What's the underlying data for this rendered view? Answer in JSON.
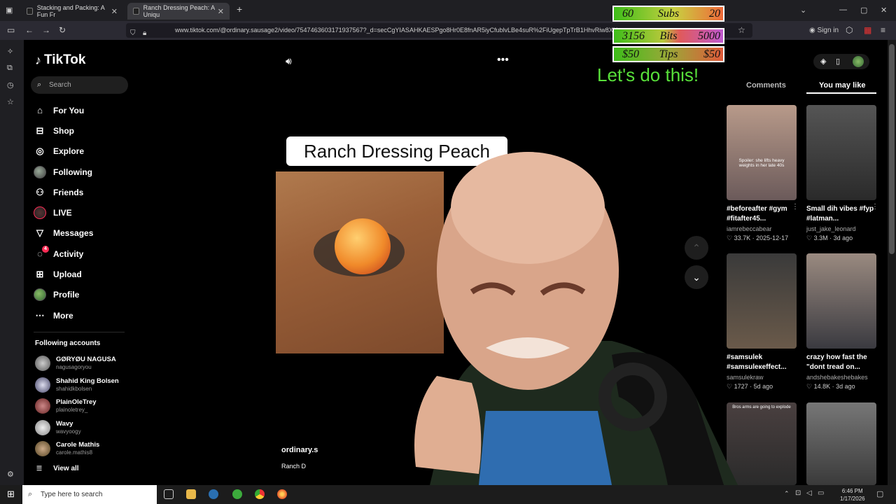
{
  "browser": {
    "tabs": [
      {
        "title": "Stacking and Packing: A Fun Fr"
      },
      {
        "title": "Ranch Dressing Peach: A Uniqu"
      }
    ],
    "url": "www.tiktok.com/@ordinary.sausage2/video/7547463603171937567?_d=secCgYIASAHKAESPgo8Hr0E8fnAR5iyCfublvLBe4suR%2FiUgepTpTrB1HhvRiw8XN",
    "sign_in": "Sign in"
  },
  "tiktok": {
    "logo": "TikTok",
    "search_placeholder": "Search",
    "nav": [
      {
        "label": "For You"
      },
      {
        "label": "Shop"
      },
      {
        "label": "Explore"
      },
      {
        "label": "Following"
      },
      {
        "label": "Friends"
      },
      {
        "label": "LIVE"
      },
      {
        "label": "Messages"
      },
      {
        "label": "Activity"
      },
      {
        "label": "Upload"
      },
      {
        "label": "Profile"
      },
      {
        "label": "More"
      }
    ],
    "activity_badge": "4",
    "following_title": "Following accounts",
    "accounts": [
      {
        "name": "GØRYØU NAGUSA",
        "handle": "nagusagoryou"
      },
      {
        "name": "Shahid King Bolsen",
        "handle": "shahidkbolsen"
      },
      {
        "name": "PlainOleTrey",
        "handle": "plainoletrey_"
      },
      {
        "name": "Wavy",
        "handle": "wavyoogy"
      },
      {
        "name": "Carole Mathis",
        "handle": "carole.mathis8"
      }
    ],
    "view_all": "View all",
    "video": {
      "caption": "Ranch Dressing Peach",
      "author": "ordinary.s",
      "desc": "Ranch D"
    },
    "right_tabs": {
      "comments": "Comments",
      "you_may_like": "You may like"
    },
    "cards": [
      {
        "title": "#beforeafter #gym #fitafter45...",
        "user": "iamrebeccabear",
        "likes": "33.7K",
        "date": "2025-12-17",
        "thumb_text": "Spoiler: she lifts heavy weights in her late 40s"
      },
      {
        "title": "Small dih vibes #fyp #latman...",
        "user": "just_jake_leonard",
        "likes": "3.3M",
        "date": "3d ago"
      },
      {
        "title": "#samsulek #samsuleкeffect...",
        "user": "samsulekraw",
        "likes": "1727",
        "date": "5d ago"
      },
      {
        "title": "crazy how fast the \"dont tread on...",
        "user": "andshebakeshebakes",
        "likes": "14.8K",
        "date": "3d ago"
      },
      {
        "title": "",
        "user": "",
        "likes": "",
        "date": "",
        "thumb_text": "Bros arms are going to explode"
      },
      {
        "title": "",
        "user": "",
        "likes": "",
        "date": ""
      }
    ]
  },
  "overlay": {
    "subs": {
      "current": "60",
      "label": "Subs",
      "goal": "20"
    },
    "bits": {
      "current": "3156",
      "label": "Bits",
      "goal": "5000"
    },
    "tips": {
      "current": "$50",
      "label": "Tips",
      "goal": "$50"
    },
    "message": "Let's do this!"
  },
  "taskbar": {
    "search_placeholder": "Type here to search",
    "time": "6:46 PM",
    "date": "1/17/2026"
  }
}
